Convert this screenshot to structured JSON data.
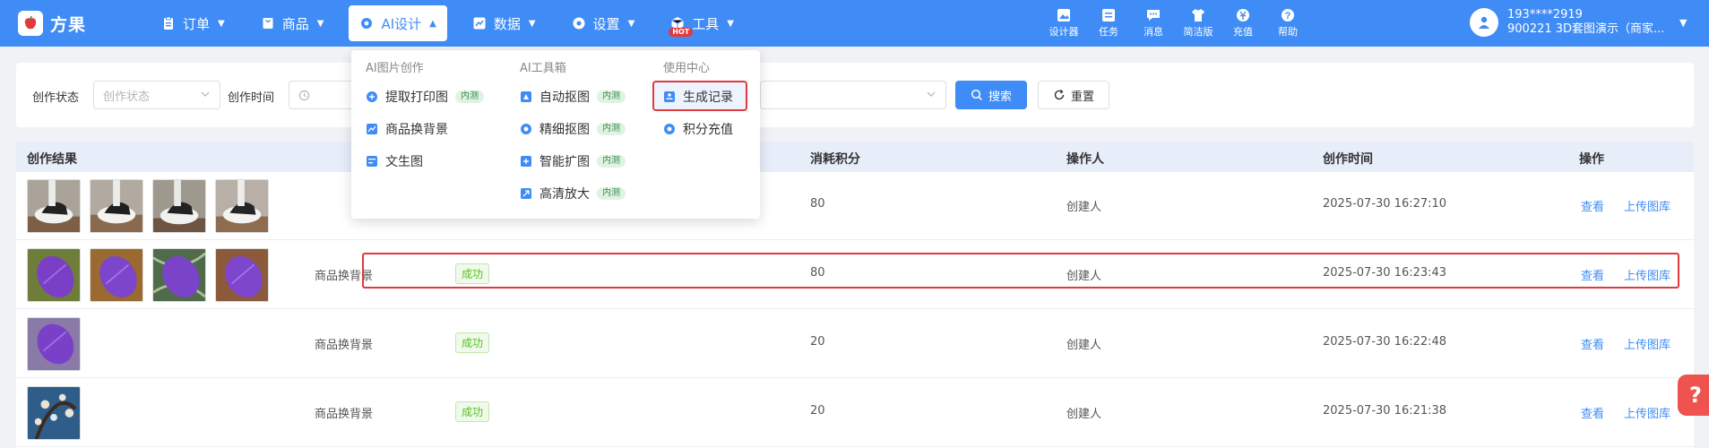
{
  "app": {
    "name": "方果"
  },
  "nav": [
    {
      "label": "订单",
      "icon": "clipboard-icon"
    },
    {
      "label": "商品",
      "icon": "bag-icon"
    },
    {
      "label": "AI设计",
      "icon": "gear-icon",
      "active": true
    },
    {
      "label": "数据",
      "icon": "chart-icon"
    },
    {
      "label": "设置",
      "icon": "settings-icon"
    },
    {
      "label": "工具",
      "icon": "box-icon",
      "badge": "HOT"
    }
  ],
  "toolbar": [
    {
      "label": "设计器",
      "icon": "image-icon"
    },
    {
      "label": "任务",
      "icon": "task-icon"
    },
    {
      "label": "消息",
      "icon": "message-icon"
    },
    {
      "label": "简洁版",
      "icon": "shirt-icon"
    },
    {
      "label": "充值",
      "icon": "coin-icon"
    },
    {
      "label": "帮助",
      "icon": "help-icon"
    }
  ],
  "user": {
    "phone": "193****2919",
    "account": "900221 3D套图演示（商家..."
  },
  "filter": {
    "status_label": "创作状态",
    "status_placeholder": "创作状态",
    "time_label": "创作时间",
    "search_button": "搜索",
    "reset_button": "重置"
  },
  "table": {
    "headers": [
      "创作结果",
      "消耗积分",
      "操作人",
      "创作时间",
      "操作"
    ],
    "rows": [
      {
        "thumbs": [
          "shoe",
          "shoe",
          "shoe",
          "shoe"
        ],
        "type": "",
        "status": "",
        "points": "80",
        "operator": "创建人",
        "time": "2025-07-30 16:27:10",
        "view": "查看",
        "upload": "上传图库"
      },
      {
        "thumbs": [
          "purple",
          "purple",
          "purple",
          "purple"
        ],
        "type": "商品换背景",
        "status": "成功",
        "points": "80",
        "operator": "创建人",
        "time": "2025-07-30 16:23:43",
        "view": "查看",
        "upload": "上传图库"
      },
      {
        "thumbs": [
          "purple"
        ],
        "type": "商品换背景",
        "status": "成功",
        "points": "20",
        "operator": "创建人",
        "time": "2025-07-30 16:22:48",
        "view": "查看",
        "upload": "上传图库"
      },
      {
        "thumbs": [
          "art"
        ],
        "type": "商品换背景",
        "status": "成功",
        "points": "20",
        "operator": "创建人",
        "time": "2025-07-30 16:21:38",
        "view": "查看",
        "upload": "上传图库"
      }
    ]
  },
  "dropdown": {
    "col1": {
      "title": "AI图片创作",
      "items": [
        {
          "label": "提取打印图",
          "tag": "内测"
        },
        {
          "label": "商品换背景",
          "tag": ""
        },
        {
          "label": "文生图",
          "tag": ""
        }
      ]
    },
    "col2": {
      "title": "AI工具箱",
      "items": [
        {
          "label": "自动抠图",
          "tag": "内测"
        },
        {
          "label": "精细抠图",
          "tag": "内测"
        },
        {
          "label": "智能扩图",
          "tag": "内测"
        },
        {
          "label": "高清放大",
          "tag": "内测"
        }
      ]
    },
    "col3": {
      "title": "使用中心",
      "items": [
        {
          "label": "生成记录",
          "tag": ""
        },
        {
          "label": "积分充值",
          "tag": ""
        }
      ]
    }
  },
  "float_help": {
    "label": "?"
  }
}
